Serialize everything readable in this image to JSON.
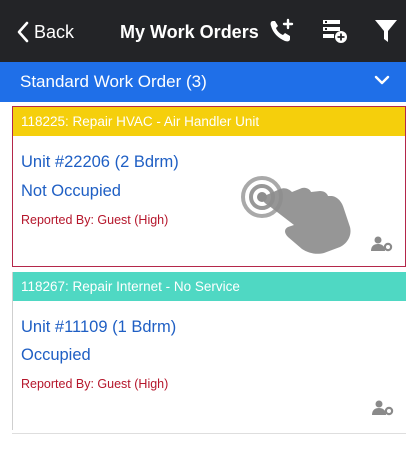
{
  "navbar": {
    "back_label": "Back",
    "title": "My Work Orders",
    "icons": [
      "back-chevron-icon",
      "add-call-icon",
      "add-filter-list-icon",
      "filter-icon"
    ]
  },
  "section": {
    "title": "Standard Work Order (3)",
    "icon": "chevron-down-icon",
    "color": "#1f6fe8"
  },
  "work_orders": [
    {
      "banner": "118225: Repair HVAC - Air Handler Unit",
      "banner_color": "#f5cf0c",
      "unit": "Unit #22206 (2 Bdrm)",
      "occupancy": "Not Occupied",
      "reported": "Reported By: Guest  (High)",
      "icon": "assign-user-icon"
    },
    {
      "banner": "118267: Repair Internet - No Service",
      "banner_color": "#4fd8c3",
      "unit": "Unit #11109 (1 Bdrm)",
      "occupancy": "Occupied",
      "reported": "Reported By: Guest  (High)",
      "icon": "assign-user-icon"
    }
  ],
  "colors": {
    "navbar": "#232427",
    "link_text": "#1f5fc4",
    "priority_text": "#b5162b",
    "selected_border": "#b4274a"
  }
}
